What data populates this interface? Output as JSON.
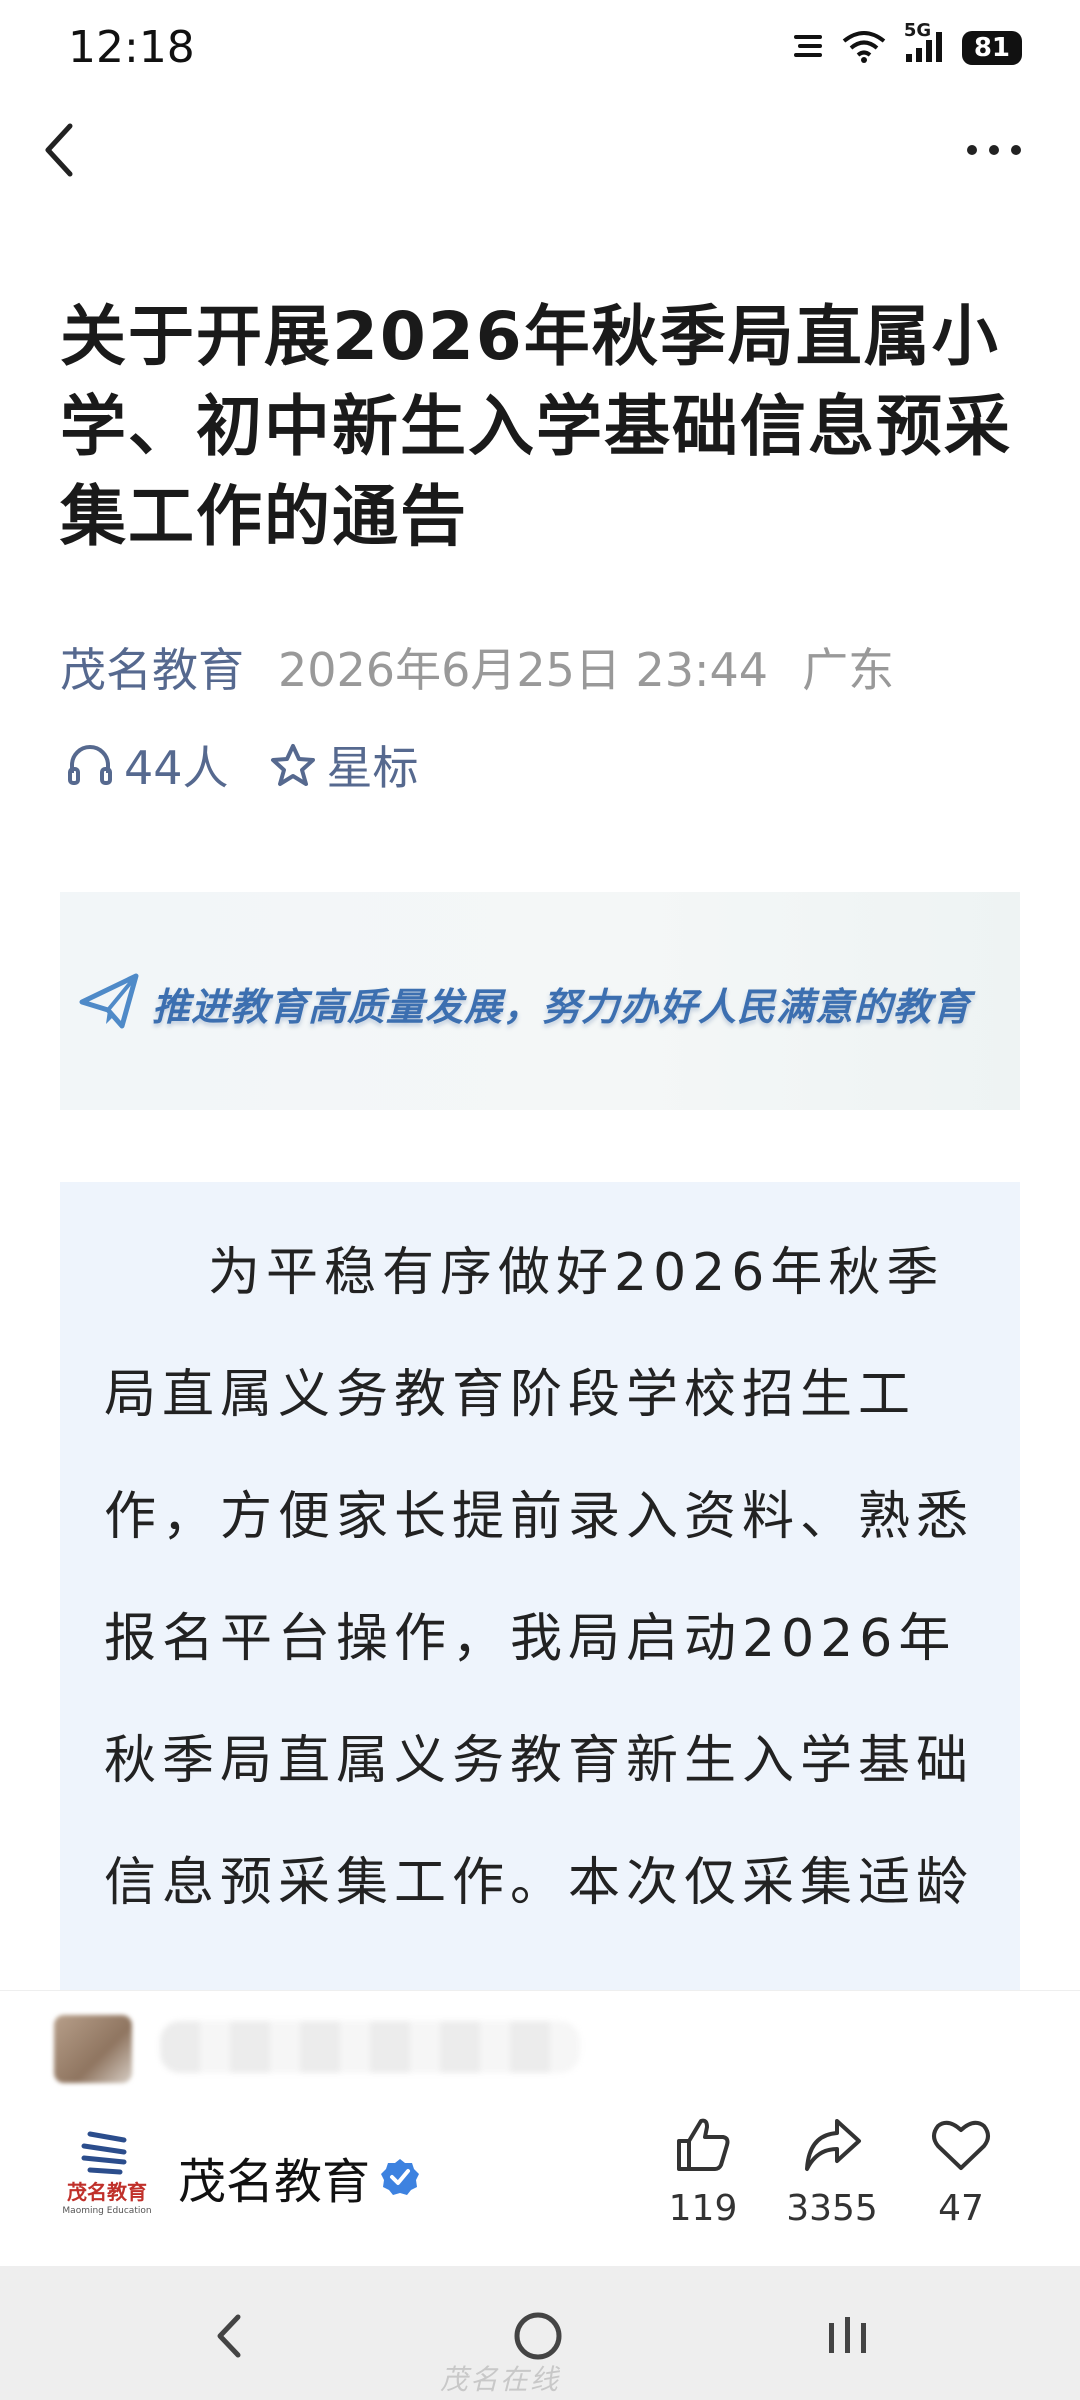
{
  "status_bar": {
    "time": "12:18",
    "network": "5G",
    "battery": "81"
  },
  "article": {
    "title": "关于开展2026年秋季局直属小学、初中新生入学基础信息预采集工作的通告",
    "source": "茂名教育",
    "datetime": "2026年6月25日 23:44",
    "location": "广东",
    "listeners": "44人",
    "star_label": "星标",
    "banner_slogan": "推进教育高质量发展，努力办好人民满意的教育",
    "body": "为平稳有序做好2026年秋季局直属义务教育阶段学校招生工作，方便家长提前录入资料、熟悉报名平台操作，我局启动2026年秋季局直属义务教育新生入学基础信息预采集工作。本次仅采集适龄"
  },
  "author_bar": {
    "name": "茂名教育",
    "logo_text": "茂名教育",
    "logo_subtext": "Maoming Education",
    "likes": "119",
    "shares": "3355",
    "favorites": "47"
  },
  "nav": {
    "watermark": "茂名在线"
  },
  "colors": {
    "accent": "#56698f",
    "verified": "#3d82e0",
    "banner_text": "#3c6fb0",
    "body_panel": "#eef4fc"
  }
}
